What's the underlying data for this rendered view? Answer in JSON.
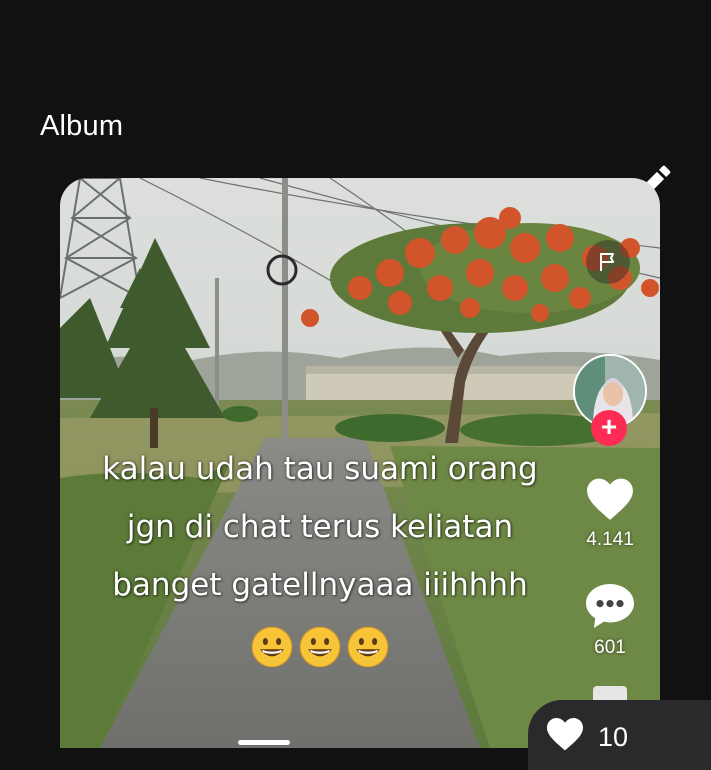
{
  "header": {
    "title": "Album"
  },
  "video": {
    "caption_lines": [
      "kalau udah tau suami orang",
      "jgn di chat terus keliatan",
      "banget gatellnyaaa iiihhhh"
    ],
    "caption_emojis": [
      "grinning-face",
      "grinning-face",
      "grinning-face"
    ]
  },
  "actions": {
    "likes": "4.141",
    "comments": "601",
    "follow_symbol": "+"
  },
  "footer": {
    "liked_count": "10"
  },
  "colors": {
    "background": "#111112",
    "follow": "#fe2c55",
    "pill": "#2a2a2c"
  }
}
